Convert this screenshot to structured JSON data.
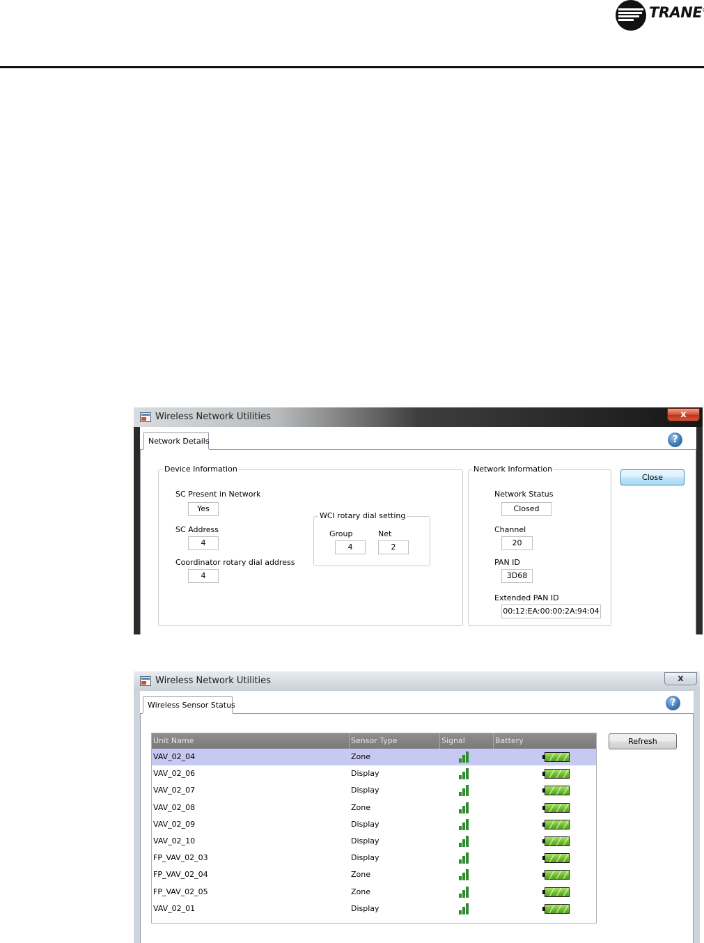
{
  "page": {
    "brand": "TRANE",
    "brand_mark": "®"
  },
  "window1": {
    "title": "Wireless Network Utilities",
    "close_label": "x",
    "tab": "Network Details",
    "help_icon": "?",
    "device_info": {
      "group_label": "Device Information",
      "sc_present_label": "SC Present in Network",
      "sc_present_value": "Yes",
      "sc_address_label": "SC Address",
      "sc_address_value": "4",
      "coordinator_label": "Coordinator rotary dial address",
      "coordinator_value": "4",
      "wci": {
        "group_label": "WCI rotary dial setting",
        "group_field_label": "Group",
        "group_value": "4",
        "net_label": "Net",
        "net_value": "2"
      }
    },
    "network_info": {
      "group_label": "Network Information",
      "status_label": "Network Status",
      "status_value": "Closed",
      "channel_label": "Channel",
      "channel_value": "20",
      "pan_id_label": "PAN ID",
      "pan_id_value": "3D68",
      "ext_pan_id_label": "Extended PAN ID",
      "ext_pan_id_value": "00:12:EA:00:00:2A:94:04"
    },
    "close_button": "Close"
  },
  "window2": {
    "title": "Wireless Network Utilities",
    "close_label": "x",
    "tab": "Wireless Sensor Status",
    "help_icon": "?",
    "refresh_button": "Refresh",
    "columns": [
      "Unit Name",
      "Sensor Type",
      "Signal",
      "Battery"
    ],
    "rows": [
      {
        "unit": "VAV_02_04",
        "type": "Zone",
        "signal": "full",
        "battery": "full",
        "selected": true
      },
      {
        "unit": "VAV_02_06",
        "type": "Display",
        "signal": "full",
        "battery": "full"
      },
      {
        "unit": "VAV_02_07",
        "type": "Display",
        "signal": "full",
        "battery": "full"
      },
      {
        "unit": "VAV_02_08",
        "type": "Zone",
        "signal": "full",
        "battery": "full"
      },
      {
        "unit": "VAV_02_09",
        "type": "Display",
        "signal": "full",
        "battery": "full"
      },
      {
        "unit": "VAV_02_10",
        "type": "Display",
        "signal": "full",
        "battery": "full"
      },
      {
        "unit": "FP_VAV_02_03",
        "type": "Display",
        "signal": "full",
        "battery": "full"
      },
      {
        "unit": "FP_VAV_02_04",
        "type": "Zone",
        "signal": "full",
        "battery": "full"
      },
      {
        "unit": "FP_VAV_02_05",
        "type": "Zone",
        "signal": "full",
        "battery": "full"
      },
      {
        "unit": "VAV_02_01",
        "type": "Display",
        "signal": "full",
        "battery": "full"
      }
    ]
  },
  "colors": {
    "signal_green": "#2e8b2e",
    "battery_green": "#6fbf2c",
    "selected_row": "#c6c9f1",
    "header_gray": "#7a7a7a"
  }
}
